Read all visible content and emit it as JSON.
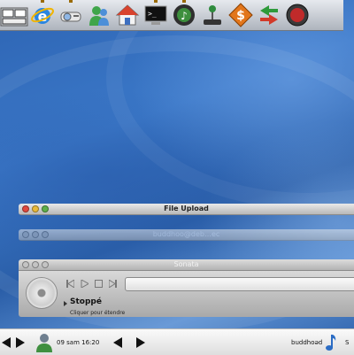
{
  "dock": {
    "items": [
      {
        "name": "expose-icon",
        "running": false
      },
      {
        "name": "internet-explorer-icon",
        "running": true
      },
      {
        "name": "projector-icon",
        "running": true
      },
      {
        "name": "messenger-user-icon",
        "running": false
      },
      {
        "name": "home-folder-icon",
        "running": false
      },
      {
        "name": "terminal-icon",
        "running": true
      },
      {
        "name": "music-player-icon",
        "running": true
      },
      {
        "name": "joystick-game-icon",
        "running": false
      },
      {
        "name": "dollar-money-icon",
        "running": false
      },
      {
        "name": "sync-arrows-icon",
        "running": false
      },
      {
        "name": "power-button-icon",
        "running": false
      }
    ]
  },
  "windows": {
    "file_upload": {
      "title": "File Upload"
    },
    "second": {
      "title": "buddhoo@deb…ec"
    },
    "player": {
      "title": "Sonata",
      "status": "Stoppé",
      "expand_hint": "Cliquer pour étendre"
    }
  },
  "taskbar": {
    "datetime": "09 sam 16:20",
    "username": "buddhoəd",
    "right_text": "S"
  },
  "colors": {
    "desktop_blue": "#3b78c8",
    "close": "#e0493e",
    "minimize": "#e8b93a",
    "zoom": "#5fb04a"
  }
}
